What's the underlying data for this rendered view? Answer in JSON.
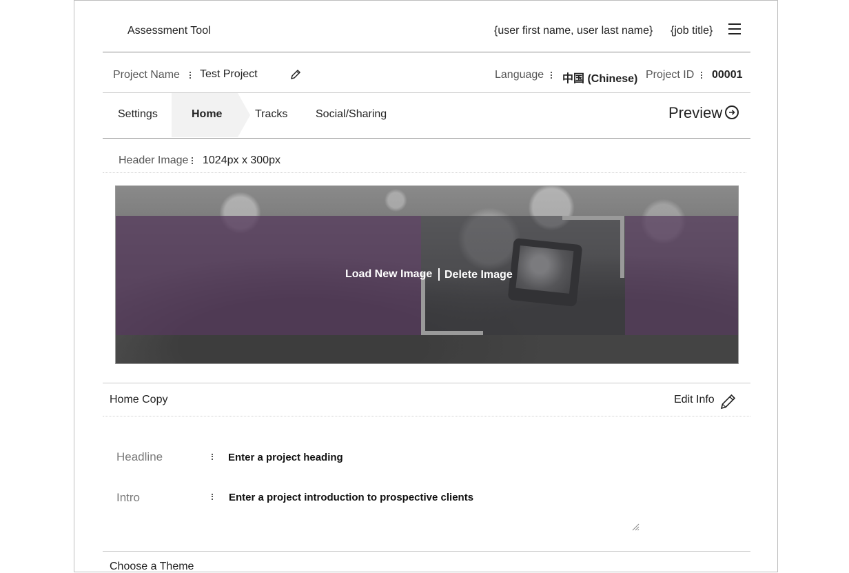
{
  "header": {
    "app_title": "Assessment Tool",
    "user_name": "{user first name, user last name}",
    "job_title": "{job title}",
    "menu_icon": "hamburger-icon"
  },
  "project_bar": {
    "name_label": "Project Name",
    "name_value": "Test Project",
    "edit_icon": "pencil-icon",
    "language_label": "Language",
    "language_value": "中国 (Chinese)",
    "id_label": "Project ID",
    "id_value": "00001"
  },
  "tabs": [
    {
      "label": "Settings",
      "active": false
    },
    {
      "label": "Home",
      "active": true
    },
    {
      "label": "Tracks",
      "active": false
    },
    {
      "label": "Social/Sharing",
      "active": false
    }
  ],
  "preview": {
    "label": "Preview",
    "icon": "arrow-circle-right-icon"
  },
  "header_image": {
    "label": "Header Image",
    "size": "1024px x 300px",
    "load_label": "Load New Image",
    "separator": "|",
    "delete_label": "Delete Image"
  },
  "home_copy": {
    "section_label": "Home Copy",
    "edit_label": "Edit Info",
    "edit_icon": "pencil-icon",
    "headline_label": "Headline",
    "headline_value": "Enter a project heading",
    "intro_label": "Intro",
    "intro_value": "Enter a project introduction to prospective clients"
  },
  "next_section": {
    "label": "Choose a Theme"
  },
  "colors": {
    "accent_purple": "#563a5c",
    "tab_active_bg": "#f2f2f2",
    "rule": "#c9c9c9"
  }
}
